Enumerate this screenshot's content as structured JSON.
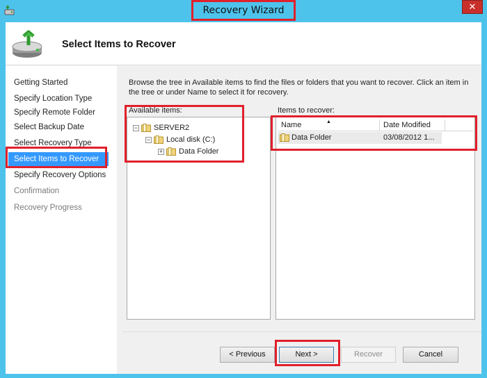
{
  "window": {
    "title": "Recovery Wizard",
    "close_glyph": "✕"
  },
  "header": {
    "title": "Select Items to Recover"
  },
  "nav": {
    "items": [
      {
        "label": "Getting Started",
        "state": "done"
      },
      {
        "label": "Specify Location Type",
        "state": "done"
      },
      {
        "label": "Specify Remote Folder",
        "state": "done"
      },
      {
        "label": "Select Backup Date",
        "state": "done"
      },
      {
        "label": "Select Recovery Type",
        "state": "done"
      },
      {
        "label": "Select Items to Recover",
        "state": "active"
      },
      {
        "label": "Specify Recovery Options",
        "state": "done"
      },
      {
        "label": "Confirmation",
        "state": "disabled"
      },
      {
        "label": "Recovery Progress",
        "state": "disabled"
      }
    ]
  },
  "main": {
    "description": "Browse the tree in Available items to find the files or folders that you want to recover. Click an item in the tree or under Name to select it for recovery.",
    "available_label": "Available items:",
    "recover_label": "Items to recover:",
    "tree": [
      {
        "label": "SERVER2",
        "expander": "−",
        "icon": "server-icon"
      },
      {
        "label": "Local disk (C:)",
        "expander": "−",
        "icon": "drive-icon"
      },
      {
        "label": "Data Folder",
        "expander": "+",
        "icon": "folder-icon"
      }
    ],
    "columns": {
      "name": "Name",
      "date": "Date Modified",
      "sort_glyph": "▲"
    },
    "rows": [
      {
        "name": "Data Folder",
        "date": "03/08/2012 1..."
      }
    ]
  },
  "buttons": {
    "previous": "< Previous",
    "next": "Next >",
    "recover": "Recover",
    "cancel": "Cancel"
  },
  "colors": {
    "accent": "#3399ff",
    "highlight_box": "#e0202b",
    "titlebar": "#4dc3ec"
  }
}
